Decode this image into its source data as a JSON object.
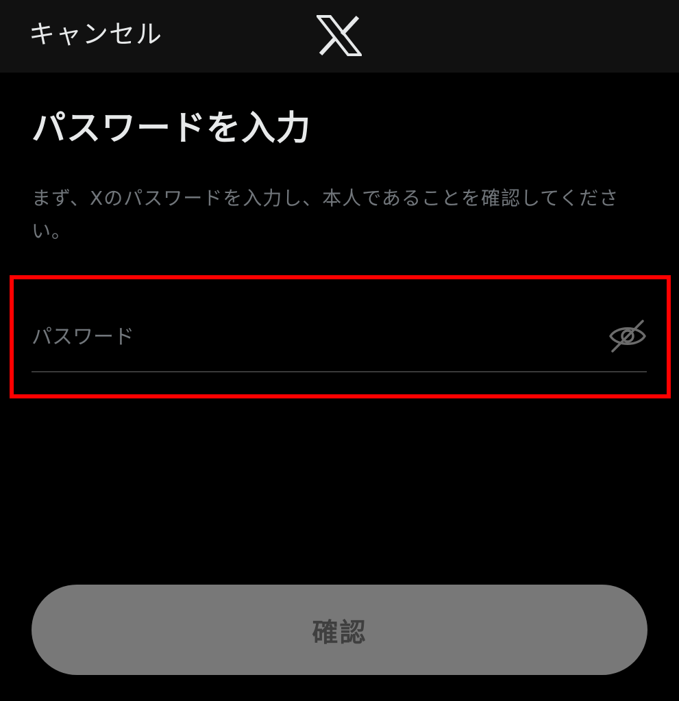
{
  "header": {
    "cancel_label": "キャンセル",
    "logo_icon": "x-logo-icon"
  },
  "main": {
    "title": "パスワードを入力",
    "description": "まず、Xのパスワードを入力し、本人であることを確認してください。"
  },
  "password": {
    "value": "",
    "placeholder": "パスワード",
    "toggle_icon": "eye-slash-icon"
  },
  "confirm": {
    "label": "確認"
  },
  "colors": {
    "background": "#000000",
    "header_bg": "#111111",
    "text_primary": "#e7e9ea",
    "text_secondary": "#71767b",
    "button_bg": "#787878",
    "button_text": "#3f3f3f",
    "highlight": "#ff0000"
  }
}
